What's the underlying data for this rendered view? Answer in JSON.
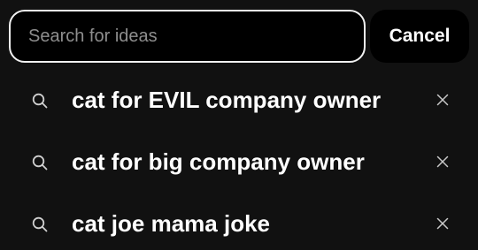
{
  "search": {
    "placeholder": "Search for ideas",
    "value": "",
    "cancel_label": "Cancel"
  },
  "suggestions": [
    {
      "label": "cat for EVIL company owner",
      "icon": "search-icon",
      "remove_icon": "close-icon"
    },
    {
      "label": "cat for big company owner",
      "icon": "search-icon",
      "remove_icon": "close-icon"
    },
    {
      "label": "cat joe mama joke",
      "icon": "search-icon",
      "remove_icon": "close-icon"
    }
  ],
  "colors": {
    "background": "#111111",
    "field_background": "#000000",
    "field_border": "#f1f1f1",
    "text": "#ffffff",
    "placeholder": "#8e8e8e",
    "icon": "#d0d0d0"
  }
}
